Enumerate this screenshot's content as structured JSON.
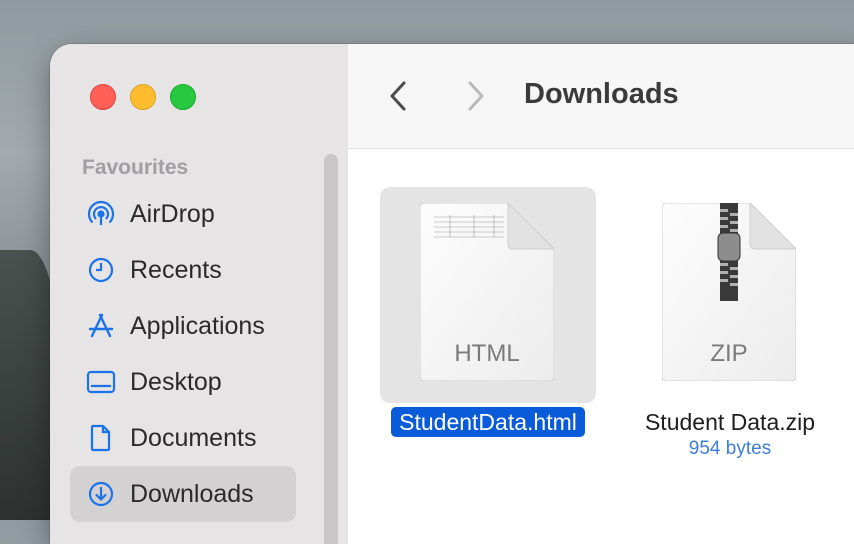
{
  "window": {
    "title": "Downloads"
  },
  "sidebar": {
    "section_title": "Favourites",
    "items": [
      {
        "label": "AirDrop",
        "icon": "airdrop-icon"
      },
      {
        "label": "Recents",
        "icon": "clock-icon"
      },
      {
        "label": "Applications",
        "icon": "applications-icon"
      },
      {
        "label": "Desktop",
        "icon": "desktop-icon"
      },
      {
        "label": "Documents",
        "icon": "document-icon"
      },
      {
        "label": "Downloads",
        "icon": "download-icon",
        "selected": true
      }
    ]
  },
  "toolbar": {
    "title": "Downloads"
  },
  "files": [
    {
      "name": "StudentData.html",
      "type_label": "HTML",
      "selected": true
    },
    {
      "name": "Student Data.zip",
      "type_label": "ZIP",
      "meta": "954 bytes"
    }
  ],
  "colors": {
    "accent": "#0a5bd9",
    "close": "#fe5f57",
    "minimize": "#febc2e",
    "zoom": "#28c840"
  }
}
